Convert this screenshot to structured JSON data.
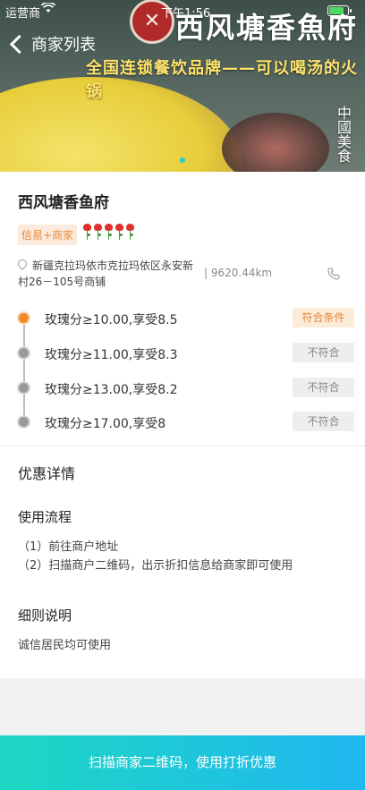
{
  "status_bar": {
    "carrier": "运营商",
    "time": "下午1:56"
  },
  "nav": {
    "back_label": "商家列表"
  },
  "banner": {
    "brand": "西风塘香魚府",
    "slogan": "全国连锁餐饮品牌——可以喝汤的火锅",
    "calligraphy": "中國美食",
    "accent": "#21d0c7"
  },
  "merchant": {
    "name": "西风塘香鱼府",
    "tag": "信易+商家",
    "rating_roses": 5,
    "address": "新疆克拉玛依市克拉玛依区永安新村26－105号商铺",
    "distance": "| 9620.44km",
    "icons": {
      "address": "location-pin-icon",
      "phone": "phone-icon"
    }
  },
  "tiers": [
    {
      "text": "玫瑰分≥10.00,享受8.5",
      "status": "符合条件",
      "eligible": true
    },
    {
      "text": "玫瑰分≥11.00,享受8.3",
      "status": "不符合",
      "eligible": false
    },
    {
      "text": "玫瑰分≥13.00,享受8.2",
      "status": "不符合",
      "eligible": false
    },
    {
      "text": "玫瑰分≥17.00,享受8",
      "status": "不符合",
      "eligible": false
    }
  ],
  "details": {
    "title": "优惠详情",
    "process_title": "使用流程",
    "process_steps": [
      "（1）前往商户地址",
      "（2）扫描商户二维码，出示折扣信息给商家即可使用"
    ],
    "rules_title": "细则说明",
    "rules_text": "诚信居民均可使用"
  },
  "cta": {
    "label": "扫描商家二维码，使用打折优惠",
    "colors": [
      "#1ed7c3",
      "#1fb7f0"
    ]
  }
}
